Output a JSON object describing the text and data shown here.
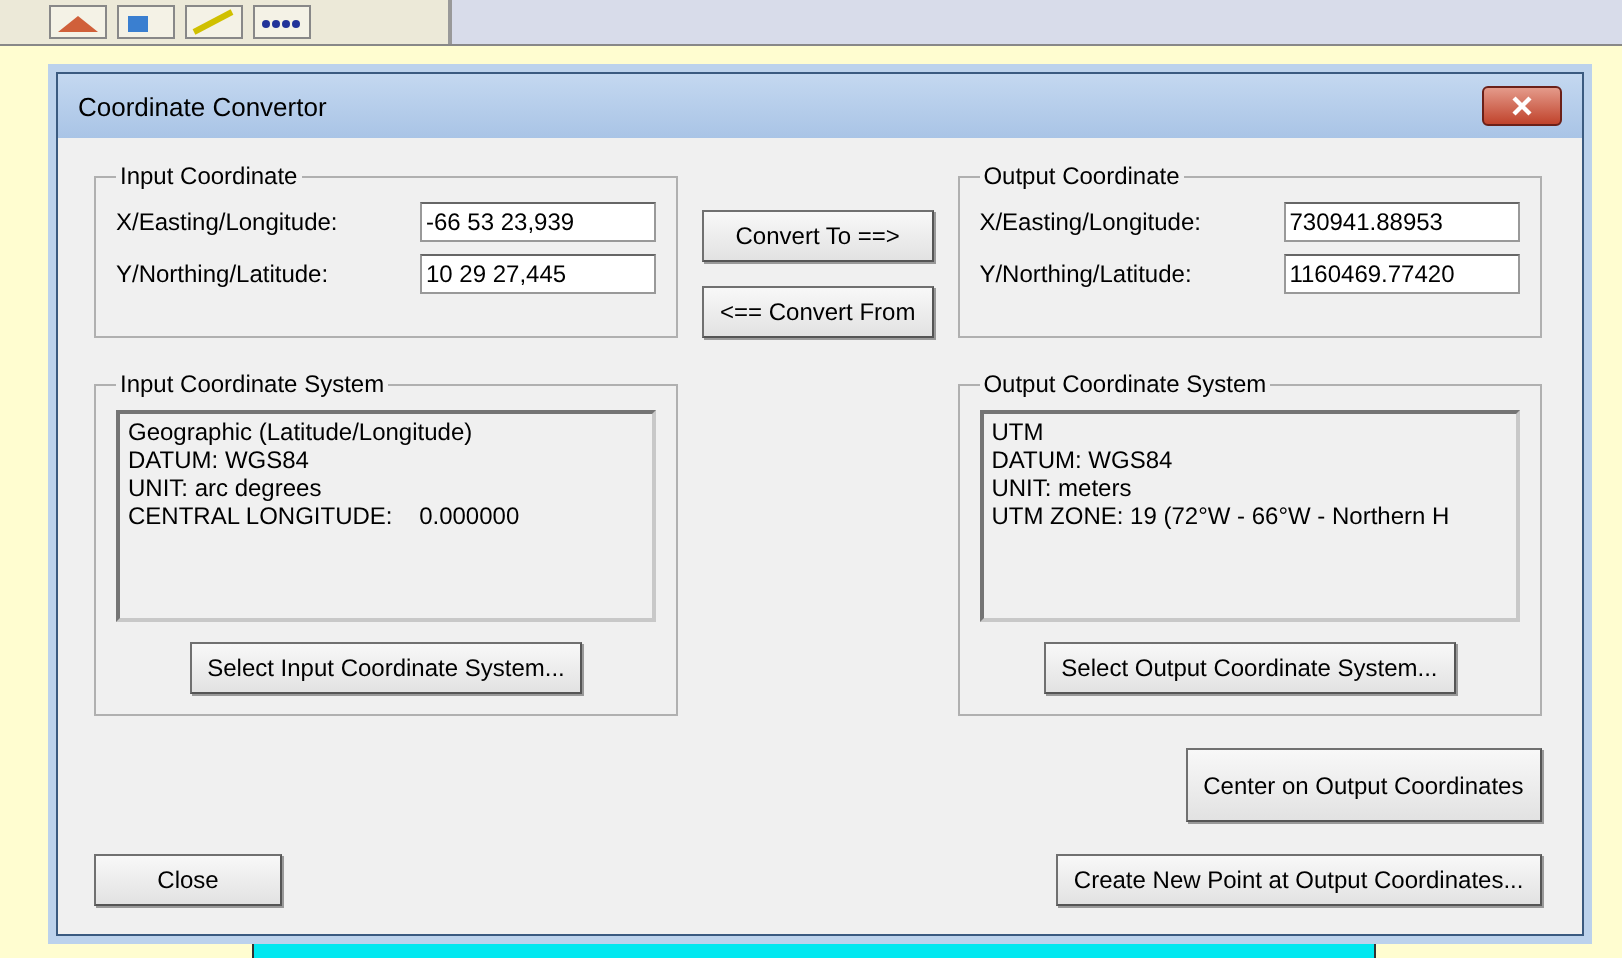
{
  "window": {
    "title": "Coordinate Convertor"
  },
  "input_coordinate": {
    "title": "Input Coordinate",
    "fields": [
      {
        "label": "X/Easting/Longitude:",
        "value": "-66 53 23,939"
      },
      {
        "label": "Y/Northing/Latitude:",
        "value": "10 29 27,445"
      }
    ]
  },
  "convert_buttons": [
    "Convert To ==>",
    "<== Convert From"
  ],
  "output_coordinate": {
    "title": "Output Coordinate",
    "fields": [
      {
        "label": "X/Easting/Longitude:",
        "value": "730941.88953"
      },
      {
        "label": "Y/Northing/Latitude:",
        "value": "1160469.77420"
      }
    ]
  },
  "input_system": {
    "title": "Input Coordinate System",
    "lines": [
      "Geographic (Latitude/Longitude)",
      "DATUM: WGS84",
      "UNIT: arc degrees",
      "CENTRAL LONGITUDE:    0.000000"
    ],
    "button": "Select Input Coordinate System..."
  },
  "output_system": {
    "title": "Output Coordinate System",
    "lines": [
      "UTM",
      "DATUM: WGS84",
      "UNIT: meters",
      "UTM ZONE: 19 (72°W - 66°W - Northern H"
    ],
    "button": "Select Output Coordinate System..."
  },
  "buttons": {
    "center": "Center on Output Coordinates",
    "close": "Close",
    "create": "Create New Point at Output Coordinates..."
  }
}
